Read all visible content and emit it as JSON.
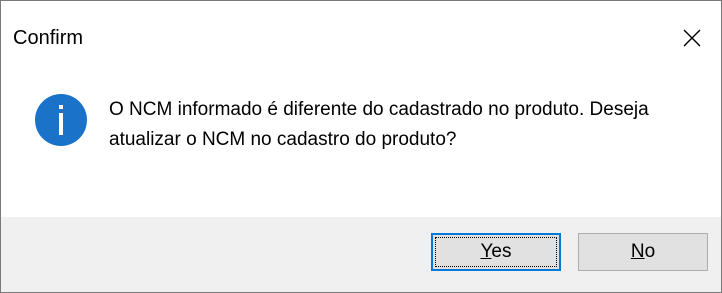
{
  "dialog": {
    "title": "Confirm",
    "close_icon": "close-icon",
    "message": "O NCM informado é diferente do cadastrado no produto. Deseja atualizar o NCM no cadastro do produto?",
    "icon": "info-icon",
    "colors": {
      "icon_fill": "#1a73c8",
      "button_focus_border": "#0078d7",
      "footer_bg": "#f0f0f0",
      "button_bg": "#e1e1e1"
    }
  },
  "buttons": {
    "yes_accel": "Y",
    "yes_rest": "es",
    "no_accel": "N",
    "no_rest": "o"
  }
}
